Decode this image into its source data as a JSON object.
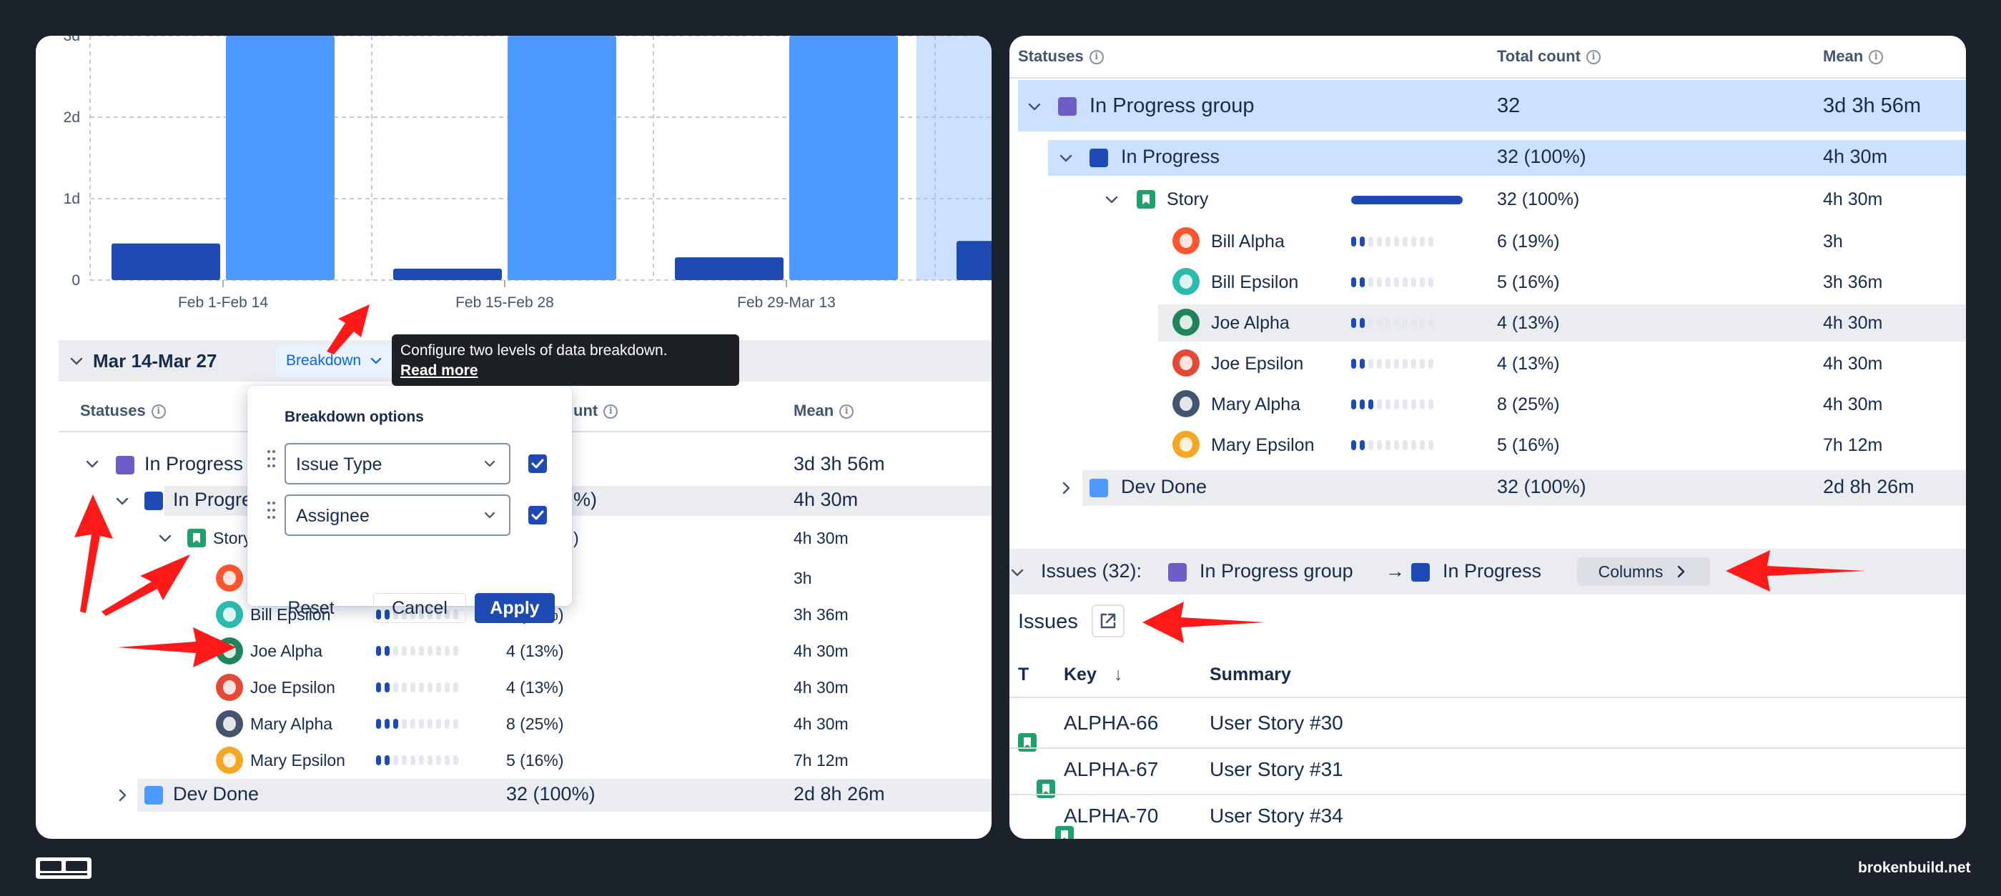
{
  "chart_data": {
    "type": "bar",
    "categories": [
      "Feb 1-Feb 14",
      "Feb 15-Feb 28",
      "Feb 29-Mar 13",
      "Mar 14-Mar 27"
    ],
    "y_tick_labels": [
      "0",
      "1d",
      "2d",
      "3d"
    ],
    "ylim": [
      0,
      3
    ],
    "y_unit": "days",
    "grid": true,
    "series": [
      {
        "values": [
          0.45,
          0.14,
          0.28,
          0.48
        ],
        "color": "#1d4ab3"
      },
      {
        "values": [
          3.2,
          3.2,
          3.2,
          3.2
        ],
        "color": "#4c9aff"
      }
    ],
    "highlighted_category": "Mar 14-Mar 27"
  },
  "colors": {
    "in_progress_group": "#6e5dc6",
    "in_progress": "#1d4ab3",
    "dev_done": "#4c9aff",
    "story": "#22a06b",
    "accent": "#0c66e4",
    "arrow": "#ff1a1a"
  },
  "left": {
    "period": "Mar 14-Mar 27",
    "breakdown_label": "Breakdown",
    "tooltip": {
      "text": "Configure two levels of data breakdown.",
      "link": "Read more"
    },
    "popup": {
      "title": "Breakdown options",
      "level1": "Issue Type",
      "level2": "Assignee",
      "reset": "Reset",
      "cancel": "Cancel",
      "apply": "Apply"
    },
    "headers": {
      "statuses": "Statuses",
      "count": "unt",
      "mean": "Mean"
    },
    "rows": {
      "group_name": "In Progress",
      "group_mean": "3d 3h 56m",
      "inprog_name": "In Progre",
      "inprog_count": "%)",
      "inprog_mean": "4h 30m",
      "story_name": "Story",
      "story_count": ")",
      "story_mean": "4h 30m"
    },
    "people": [
      {
        "name": "",
        "count": "",
        "mean": "3h"
      },
      {
        "name": "Bill Epsilon",
        "count": "5 (16%)",
        "mean": "3h 36m"
      },
      {
        "name": "Joe Alpha",
        "count": "4 (13%)",
        "mean": "4h 30m"
      },
      {
        "name": "Joe Epsilon",
        "count": "4 (13%)",
        "mean": "4h 30m"
      },
      {
        "name": "Mary Alpha",
        "count": "8 (25%)",
        "mean": "4h 30m"
      },
      {
        "name": "Mary Epsilon",
        "count": "5 (16%)",
        "mean": "7h 12m"
      }
    ],
    "dev_done": {
      "name": "Dev Done",
      "count": "32 (100%)",
      "mean": "2d 8h 26m"
    }
  },
  "right": {
    "headers": {
      "statuses": "Statuses",
      "total": "Total count",
      "mean": "Mean"
    },
    "group": {
      "name": "In Progress group",
      "count": "32",
      "mean": "3d 3h 56m"
    },
    "inprog": {
      "name": "In Progress",
      "count": "32 (100%)",
      "mean": "4h 30m"
    },
    "story": {
      "name": "Story",
      "count": "32 (100%)",
      "mean": "4h 30m"
    },
    "people": [
      {
        "name": "Bill Alpha",
        "count": "6 (19%)",
        "mean": "3h"
      },
      {
        "name": "Bill Epsilon",
        "count": "5 (16%)",
        "mean": "3h 36m"
      },
      {
        "name": "Joe Alpha",
        "count": "4 (13%)",
        "mean": "4h 30m"
      },
      {
        "name": "Joe Epsilon",
        "count": "4 (13%)",
        "mean": "4h 30m"
      },
      {
        "name": "Mary Alpha",
        "count": "8 (25%)",
        "mean": "4h 30m"
      },
      {
        "name": "Mary Epsilon",
        "count": "5 (16%)",
        "mean": "7h 12m"
      }
    ],
    "dev_done": {
      "name": "Dev Done",
      "count": "32 (100%)",
      "mean": "2d 8h 26m"
    },
    "issues_bar": {
      "prefix": "Issues (32):",
      "from": "In Progress group",
      "arrow": "→",
      "to": "In Progress",
      "columns": "Columns"
    },
    "issues_title": "Issues",
    "table": {
      "headers": {
        "type": "T",
        "key": "Key",
        "sort": "↓",
        "summary": "Summary"
      },
      "rows": [
        {
          "key": "ALPHA-66",
          "summary": "User Story #30"
        },
        {
          "key": "ALPHA-67",
          "summary": "User Story #31"
        },
        {
          "key": "ALPHA-70",
          "summary": "User Story #34"
        }
      ]
    }
  },
  "footer": {
    "site": "brokenbuild.net",
    "logo": "BB"
  },
  "avatar_colors": [
    "#ff5630",
    "#2abbac",
    "#1f845a",
    "#e34935",
    "#44546f",
    "#f5a623"
  ]
}
